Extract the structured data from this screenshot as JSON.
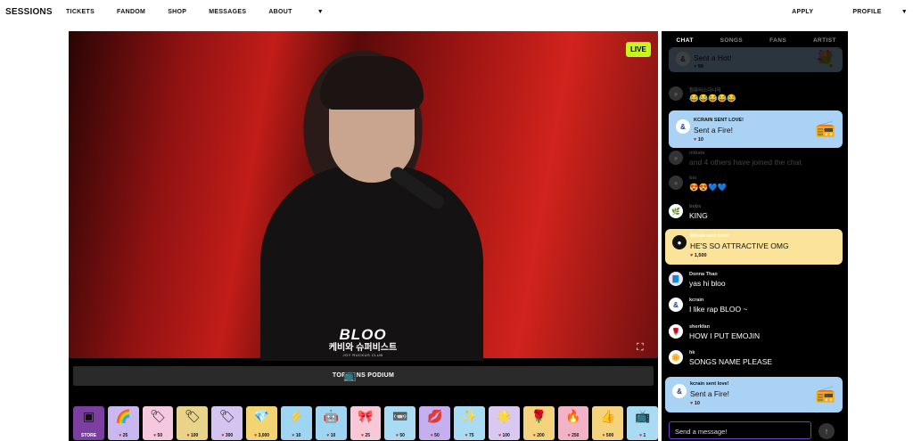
{
  "nav": {
    "brand": "SESSIONS",
    "links": [
      "TICKETS",
      "FANDOM",
      "SHOP",
      "MESSAGES",
      "ABOUT"
    ],
    "about_chevron": "chevron-down-icon",
    "apply": "APPLY",
    "profile": "PROFILE"
  },
  "stage": {
    "live_label": "LIVE",
    "artist_name": "BLOO",
    "korean_title": "케비와 슈퍼비스트",
    "club_name": "JOY RUCKUS CLUB",
    "podium_label": "TOP FANS PODIUM",
    "fullscreen_icon": "fullscreen-icon"
  },
  "gifts": [
    {
      "icon": "store-icon",
      "label": "STORE"
    },
    {
      "icon": "rainbow-sticker-icon",
      "price": "25"
    },
    {
      "icon": "vote-badge-icon",
      "price": "50"
    },
    {
      "icon": "vote-badge-icon",
      "price": "100"
    },
    {
      "icon": "vote-badge-icon",
      "price": "300"
    },
    {
      "icon": "gem-sticker-icon",
      "price": "3,000"
    },
    {
      "icon": "lightning-icon",
      "price": "10"
    },
    {
      "icon": "robot-icon",
      "price": "10"
    },
    {
      "icon": "heart-bow-icon",
      "price": "25"
    },
    {
      "icon": "cassette-icon",
      "price": "50"
    },
    {
      "icon": "lips-icon",
      "price": "50"
    },
    {
      "icon": "swag-sticker-icon",
      "price": "75"
    },
    {
      "icon": "sparkle-sticker-icon",
      "price": "100"
    },
    {
      "icon": "rose-sticker-icon",
      "price": "200"
    },
    {
      "icon": "fire-sticker-icon",
      "price": "250"
    },
    {
      "icon": "nice-sticker-icon",
      "price": "500"
    },
    {
      "icon": "tv-sticker-icon",
      "price": "1"
    }
  ],
  "chat": {
    "tabs": [
      "CHAT",
      "SONGS",
      "FANS",
      "ARTIST"
    ],
    "active_tab": "CHAT",
    "messages": [
      {
        "text": "Sent a Hot!",
        "hearts": "99"
      },
      {
        "user": "컴퓨터스다니저",
        "text": "😂😂😂😂😂"
      },
      {
        "user": "KCRAIN SENT LOVE!",
        "text": "Sent a Fire!",
        "hearts": "10"
      },
      {
        "user": "mikala",
        "text": "and 4 others have joined the chat"
      },
      {
        "user": "bio",
        "text": "😍😍💙💙"
      },
      {
        "user": "bobs",
        "text": "KING"
      },
      {
        "user": "Mikala sent love!",
        "text": "HE'S SO ATTRACTIVE OMG",
        "hearts": "1,500"
      },
      {
        "user": "Donna Thao",
        "text": "yas hi bloo"
      },
      {
        "user": "kcrain",
        "text": "I like rap BLOO ~"
      },
      {
        "user": "sherkfan",
        "text": "HOW I PUT EMOJIN"
      },
      {
        "user": "hk",
        "text": "SONGS NAME PLEASE"
      },
      {
        "user": "kcrain sent love!",
        "text": "Sent a Fire!",
        "hearts": "10"
      }
    ],
    "composer_placeholder": "Send a message!",
    "send_icon": "arrow-up-icon"
  },
  "colors": {
    "live": "#c6f51f",
    "love_card_blue": "#a9d2f5",
    "love_card_yellow": "#fbe39a",
    "composer_border": "#6e3fc9",
    "heart": "#d0241f"
  }
}
